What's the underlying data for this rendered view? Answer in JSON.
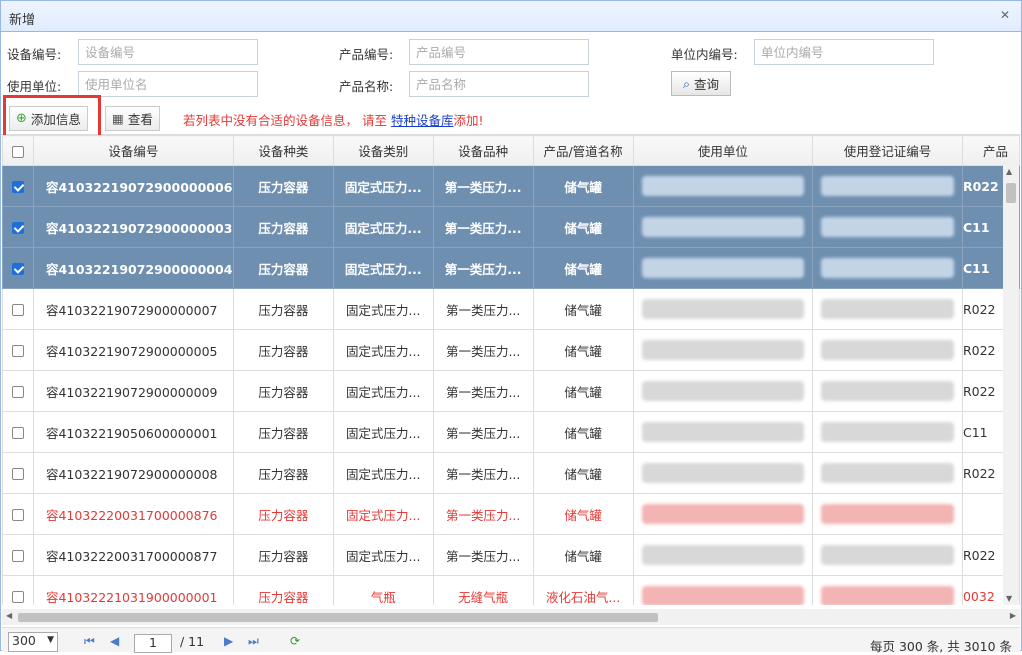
{
  "window": {
    "title": "新增"
  },
  "search": {
    "equip_code_label": "设备编号:",
    "equip_code_placeholder": "设备编号",
    "product_code_label": "产品编号:",
    "product_code_placeholder": "产品编号",
    "unit_internal_label": "单位内编号:",
    "unit_internal_placeholder": "单位内编号",
    "user_unit_label": "使用单位:",
    "user_unit_placeholder": "使用单位名",
    "product_name_label": "产品名称:",
    "product_name_placeholder": "产品名称",
    "query_label": "查询"
  },
  "toolbar": {
    "add_label": "添加信息",
    "view_label": "查看",
    "notice_prefix": "若列表中没有合适的设备信息， 请至",
    "notice_link": "特种设备库",
    "notice_suffix": "添加!"
  },
  "grid": {
    "columns": [
      "设备编号",
      "设备种类",
      "设备类别",
      "设备品种",
      "产品/管道名称",
      "使用单位",
      "使用登记证编号",
      "产品"
    ],
    "rows": [
      {
        "checked": true,
        "state": "sel",
        "code": "容41032219072900000006",
        "kind": "压力容器",
        "cat": "固定式压力...",
        "variety": "第一类压力...",
        "pname": "储气罐",
        "reg": "R022"
      },
      {
        "checked": true,
        "state": "sel",
        "code": "容41032219072900000003",
        "kind": "压力容器",
        "cat": "固定式压力...",
        "variety": "第一类压力...",
        "pname": "储气罐",
        "reg": "C11"
      },
      {
        "checked": true,
        "state": "sel",
        "code": "容41032219072900000004",
        "kind": "压力容器",
        "cat": "固定式压力...",
        "variety": "第一类压力...",
        "pname": "储气罐",
        "reg": "C11"
      },
      {
        "checked": false,
        "state": "",
        "code": "容41032219072900000007",
        "kind": "压力容器",
        "cat": "固定式压力...",
        "variety": "第一类压力...",
        "pname": "储气罐",
        "reg": "R022"
      },
      {
        "checked": false,
        "state": "",
        "code": "容41032219072900000005",
        "kind": "压力容器",
        "cat": "固定式压力...",
        "variety": "第一类压力...",
        "pname": "储气罐",
        "reg": "R022"
      },
      {
        "checked": false,
        "state": "",
        "code": "容41032219072900000009",
        "kind": "压力容器",
        "cat": "固定式压力...",
        "variety": "第一类压力...",
        "pname": "储气罐",
        "reg": "R022"
      },
      {
        "checked": false,
        "state": "",
        "code": "容41032219050600000001",
        "kind": "压力容器",
        "cat": "固定式压力...",
        "variety": "第一类压力...",
        "pname": "储气罐",
        "reg": "C11"
      },
      {
        "checked": false,
        "state": "",
        "code": "容41032219072900000008",
        "kind": "压力容器",
        "cat": "固定式压力...",
        "variety": "第一类压力...",
        "pname": "储气罐",
        "reg": "R022"
      },
      {
        "checked": false,
        "state": "red",
        "code": "容41032220031700000876",
        "kind": "压力容器",
        "cat": "固定式压力...",
        "variety": "第一类压力...",
        "pname": "储气罐",
        "reg": ""
      },
      {
        "checked": false,
        "state": "",
        "code": "容41032220031700000877",
        "kind": "压力容器",
        "cat": "固定式压力...",
        "variety": "第一类压力...",
        "pname": "储气罐",
        "reg": "R022"
      },
      {
        "checked": false,
        "state": "red",
        "code": "容41032221031900000001",
        "kind": "压力容器",
        "cat": "气瓶",
        "variety": "无缝气瓶",
        "pname": "液化石油气...",
        "reg": "0032"
      }
    ]
  },
  "pager": {
    "page_size": "300",
    "page_input": "1",
    "page_total": "/ 11",
    "info": "每页 300 条, 共 3010 条"
  },
  "colors": {
    "selected_row": "#6f8fb0",
    "warn_text": "#e53935",
    "accent": "#1e6fd9"
  }
}
